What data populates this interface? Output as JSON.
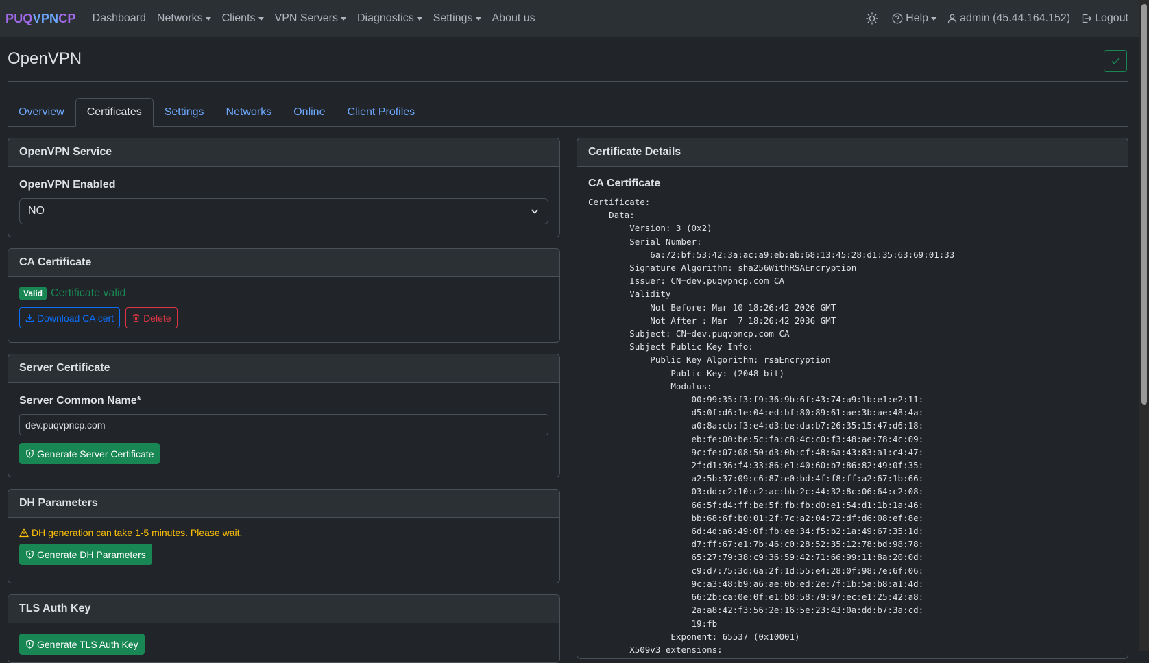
{
  "navbar": {
    "brand_part1": "PUQ",
    "brand_part2": "VPN",
    "brand_part3": "CP",
    "items": [
      {
        "label": "Dashboard",
        "dropdown": false
      },
      {
        "label": "Networks",
        "dropdown": true
      },
      {
        "label": "Clients",
        "dropdown": true
      },
      {
        "label": "VPN Servers",
        "dropdown": true
      },
      {
        "label": "Diagnostics",
        "dropdown": true
      },
      {
        "label": "Settings",
        "dropdown": true
      },
      {
        "label": "About us",
        "dropdown": false
      }
    ],
    "help_label": "Help",
    "user_label": "admin (45.44.164.152)",
    "logout_label": "Logout"
  },
  "page": {
    "title": "OpenVPN"
  },
  "tabs": [
    {
      "label": "Overview",
      "active": false
    },
    {
      "label": "Certificates",
      "active": true
    },
    {
      "label": "Settings",
      "active": false
    },
    {
      "label": "Networks",
      "active": false
    },
    {
      "label": "Online",
      "active": false
    },
    {
      "label": "Client Profiles",
      "active": false
    }
  ],
  "service": {
    "header": "OpenVPN Service",
    "enabled_label": "OpenVPN Enabled",
    "enabled_value": "NO"
  },
  "ca": {
    "header": "CA Certificate",
    "badge": "Valid",
    "status_text": "Certificate valid",
    "download_label": "Download CA cert",
    "delete_label": "Delete"
  },
  "server_cert": {
    "header": "Server Certificate",
    "common_name_label": "Server Common Name*",
    "common_name_value": "dev.puqvpncp.com",
    "generate_label": "Generate Server Certificate"
  },
  "dh": {
    "header": "DH Parameters",
    "warning": "DH generation can take 1-5 minutes. Please wait.",
    "generate_label": "Generate DH Parameters"
  },
  "tls": {
    "header": "TLS Auth Key",
    "generate_label": "Generate TLS Auth Key"
  },
  "details": {
    "header": "Certificate Details",
    "ca_title": "CA Certificate",
    "ca_text": "Certificate:\n    Data:\n        Version: 3 (0x2)\n        Serial Number:\n            6a:72:bf:53:42:3a:ac:a9:eb:ab:68:13:45:28:d1:35:63:69:01:33\n        Signature Algorithm: sha256WithRSAEncryption\n        Issuer: CN=dev.puqvpncp.com CA\n        Validity\n            Not Before: Mar 10 18:26:42 2026 GMT\n            Not After : Mar  7 18:26:42 2036 GMT\n        Subject: CN=dev.puqvpncp.com CA\n        Subject Public Key Info:\n            Public Key Algorithm: rsaEncryption\n                Public-Key: (2048 bit)\n                Modulus:\n                    00:99:35:f3:f9:36:9b:6f:43:74:a9:1b:e1:e2:11:\n                    d5:0f:d6:1e:04:ed:bf:80:89:61:ae:3b:ae:48:4a:\n                    a0:8a:cb:f3:e4:d3:be:da:b7:26:35:15:47:d6:18:\n                    eb:fe:00:be:5c:fa:c8:4c:c0:f3:48:ae:78:4c:09:\n                    9c:fe:07:08:50:d3:0b:cf:48:6a:43:83:a1:c4:47:\n                    2f:d1:36:f4:33:86:e1:40:60:b7:86:82:49:0f:35:\n                    a2:5b:37:09:c6:87:e0:bd:4f:f8:ff:a2:67:1b:66:\n                    03:dd:c2:10:c2:ac:bb:2c:44:32:8c:06:64:c2:08:\n                    66:5f:d4:ff:be:5f:fb:fb:d0:e1:54:d1:1b:1a:46:\n                    bb:68:6f:b0:01:2f:7c:a2:04:72:df:d6:08:ef:8e:\n                    6d:4d:a6:49:0f:fb:ee:34:f5:b2:1a:49:67:35:1d:\n                    d7:ff:67:e1:7b:46:c0:28:52:35:12:78:bd:98:78:\n                    65:27:79:38:c9:36:59:42:71:66:99:11:8a:20:0d:\n                    c9:d7:75:3d:6a:2f:1d:55:e4:28:0f:98:7e:6f:06:\n                    9c:a3:48:b9:a6:ae:0b:ed:2e:7f:1b:5a:b8:a1:4d:\n                    66:2b:ca:0e:0f:e1:b8:58:79:97:ec:e1:25:42:a8:\n                    2a:a8:42:f3:56:2e:16:5e:23:43:0a:dd:b7:3a:cd:\n                    19:fb\n                Exponent: 65537 (0x10001)\n        X509v3 extensions:"
  },
  "icons": {
    "theme": "sun-icon",
    "help": "question-circle-icon",
    "user": "person-icon",
    "logout": "logout-icon",
    "status": "check-icon",
    "download": "download-icon",
    "delete": "trash-icon",
    "generate": "shield-icon",
    "warning": "warning-triangle-icon"
  },
  "colors": {
    "background": "#212529",
    "navbar": "#2b3035",
    "brand_purple": "#a16ae8",
    "brand_blue": "#6ea8fe",
    "success": "#198754",
    "danger": "#dc3545",
    "primary": "#0d6efd",
    "warning": "#ffc107"
  }
}
